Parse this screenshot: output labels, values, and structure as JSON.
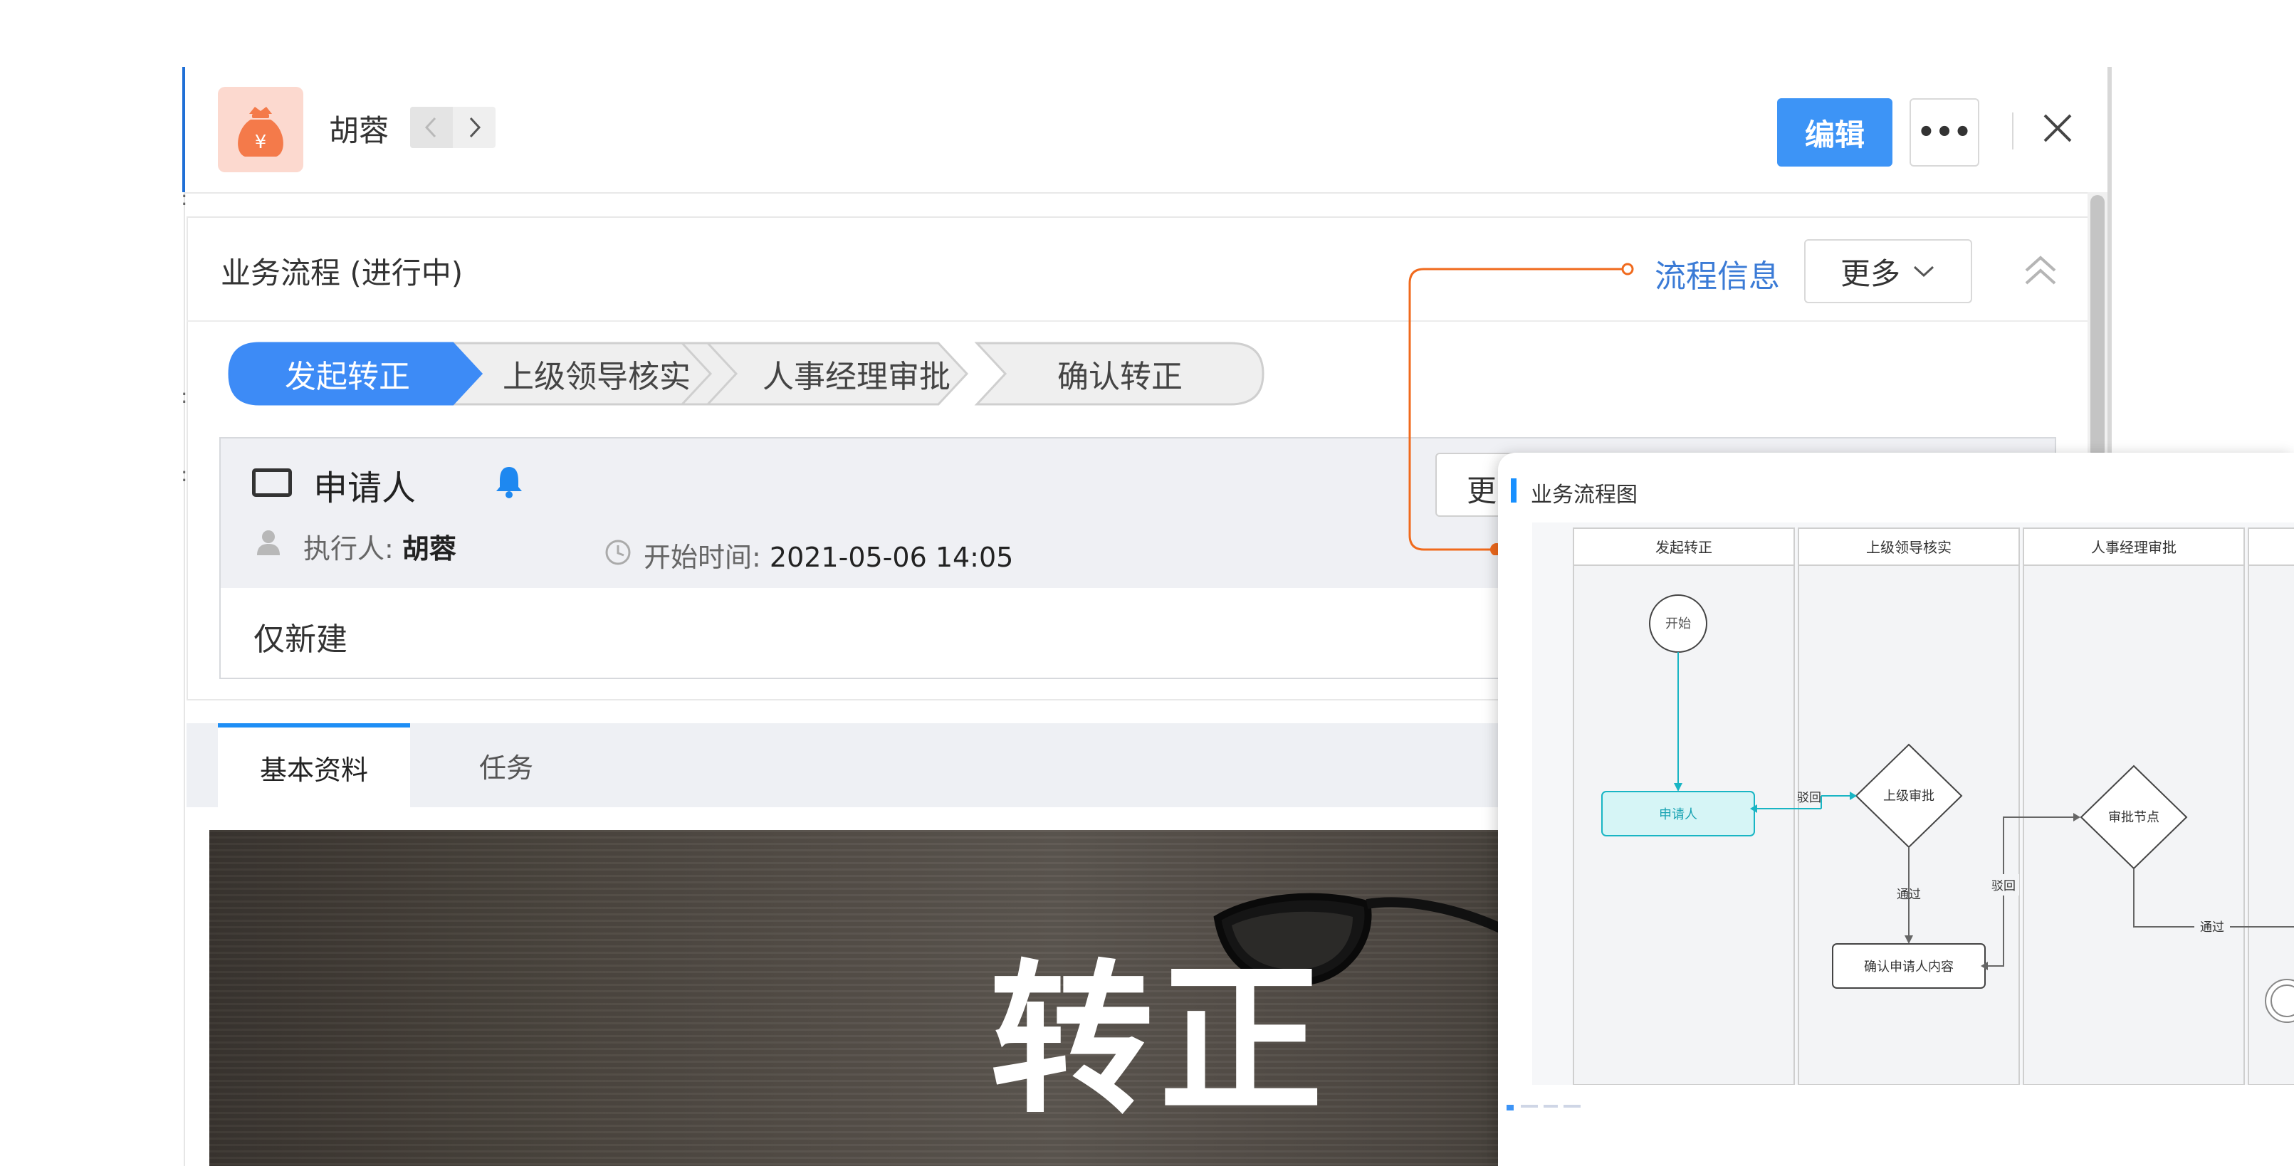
{
  "header": {
    "user_name": "胡蓉",
    "edit_label": "编辑",
    "more_dots": "•••"
  },
  "process": {
    "title": "业务流程 (进行中)",
    "flow_info_link": "流程信息",
    "more_label": "更多",
    "steps": [
      {
        "label": "发起转正",
        "active": true
      },
      {
        "label": "上级领导核实",
        "active": false
      },
      {
        "label": "人事经理审批",
        "active": false
      },
      {
        "label": "确认转正",
        "active": false
      }
    ]
  },
  "task": {
    "title": "申请人",
    "executor_label": "执行人:",
    "executor_name": "胡蓉",
    "start_time_label": "开始时间:",
    "start_time_value": "2021-05-06 14:05",
    "more_button_fragment": "更",
    "note": "仅新建"
  },
  "tabs": [
    {
      "label": "基本资料",
      "active": true
    },
    {
      "label": "任务",
      "active": false
    }
  ],
  "banner": {
    "text": "转正"
  },
  "popup": {
    "title": "业务流程图",
    "lanes": [
      "发起转正",
      "上级领导核实",
      "人事经理审批"
    ],
    "nodes": {
      "start": "开始",
      "applicant": "申请人",
      "supervisor_approval": "上级审批",
      "approval_node": "审批节点",
      "confirm_content": "确认申请人内容"
    },
    "edges": {
      "reject_1": "驳回",
      "pass_1": "通过",
      "reject_2": "驳回",
      "pass_2": "通过"
    }
  },
  "colors": {
    "accent": "#3d94f6",
    "link": "#3b7bd6",
    "connector": "#f06a1d",
    "teal": "#19b5c4",
    "icon_bg": "#fcd9cf",
    "icon_fg": "#f47a4a"
  }
}
